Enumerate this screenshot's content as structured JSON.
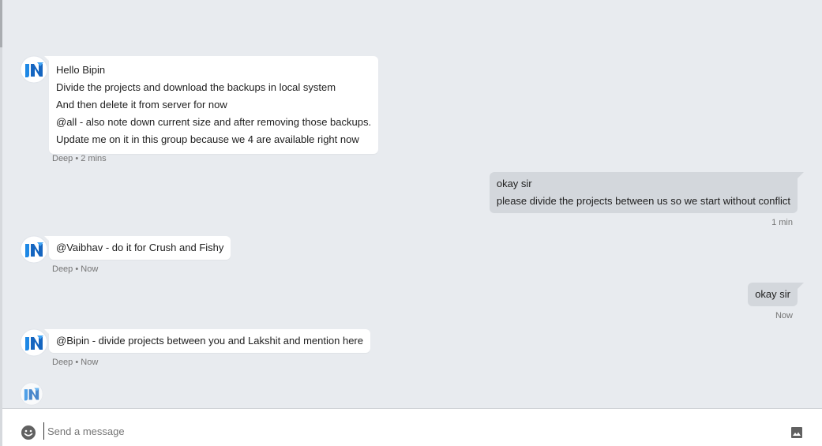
{
  "messages": [
    {
      "lines": [
        "Hello Bipin",
        "Divide the projects and download the backups in local system",
        "And then delete it from server for now",
        "@all - also note down current size and after removing those backups.",
        "Update me on it in this group because we 4 are available right now"
      ],
      "meta": "Deep • 2 mins"
    },
    {
      "lines": [
        "okay sir",
        "please divide the projects between us so we start without conflict"
      ],
      "meta": "1 min"
    },
    {
      "lines": [
        "@Vaibhav - do it for Crush and Fishy"
      ],
      "meta": "Deep • Now"
    },
    {
      "lines": [
        "okay sir"
      ],
      "meta": "Now"
    },
    {
      "lines": [
        "@Bipin - divide projects between you and Lakshit and mention here"
      ],
      "meta": "Deep • Now"
    }
  ],
  "composer": {
    "placeholder": "Send a message",
    "emoji_icon": "emoji-smile-icon",
    "image_icon": "insert-image-icon"
  },
  "colors": {
    "background": "#e8ebef",
    "incoming_bubble": "#ffffff",
    "outgoing_bubble": "#d3d7dc",
    "avatar_brand": "#1e88e5"
  }
}
